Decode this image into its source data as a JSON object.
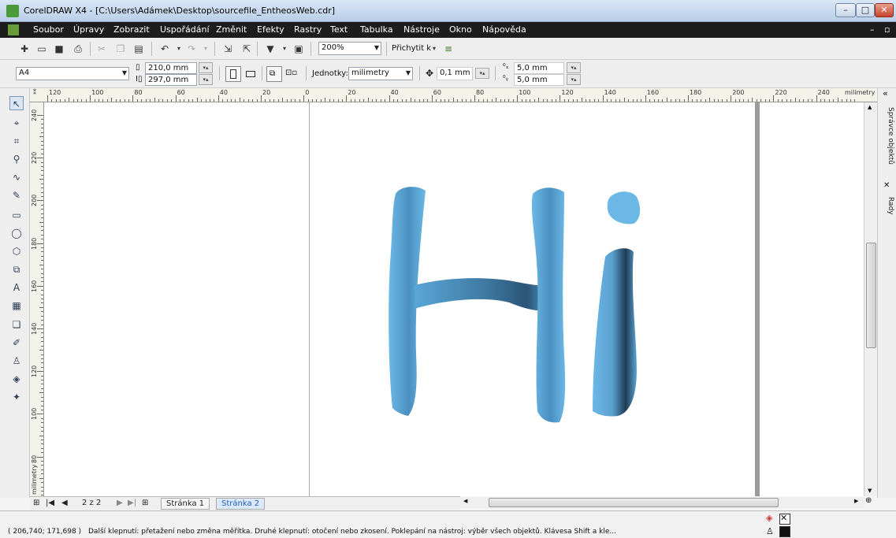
{
  "window": {
    "title": "CorelDRAW X4 - [C:\\Users\\Adámek\\Desktop\\sourcefile_EntheosWeb.cdr]",
    "minimize": "–",
    "maximize": "□",
    "close": "✕"
  },
  "menubar": {
    "items": [
      "Soubor",
      "Úpravy",
      "Zobrazit",
      "Uspořádání",
      "Změnit",
      "Efekty",
      "Rastry",
      "Text",
      "Tabulka",
      "Nástroje",
      "Okno",
      "Nápověda"
    ],
    "doc_min": "–",
    "doc_restore": "▫"
  },
  "toolbar_standard": {
    "zoom": "200%",
    "snap_label": "Přichytit k"
  },
  "toolbar_property": {
    "page_size": "A4",
    "width": "210,0 mm",
    "height": "297,0 mm",
    "units_label": "Jednotky:",
    "units_value": "milimetry",
    "nudge": "0,1 mm",
    "dup_x": "5,0 mm",
    "dup_y": "5,0 mm"
  },
  "ruler_h": {
    "labels": [
      "120",
      "100",
      "80",
      "60",
      "40",
      "20",
      "0",
      "20",
      "40",
      "60",
      "80",
      "100",
      "120",
      "140",
      "160",
      "180",
      "200",
      "220",
      "240"
    ],
    "unit": "milimetry"
  },
  "ruler_v": {
    "labels": [
      "240",
      "220",
      "200",
      "180",
      "160",
      "140",
      "120",
      "100",
      "80"
    ],
    "unit": "milimetry"
  },
  "canvas": {
    "artwork_text": "Hi",
    "colors": {
      "light_blue": "#6bb8e6",
      "mid_blue": "#4a8fc0",
      "dark_blue": "#1f3b52"
    }
  },
  "pagenav": {
    "page_counter": "2 z 2",
    "tabs": [
      "Stránka 1",
      "Stránka 2"
    ],
    "active_tab": 1
  },
  "docker": {
    "tabs": [
      "Správce objektů",
      "Rady"
    ],
    "collapse": "«",
    "close": "✕"
  },
  "statusbar": {
    "coords": "( 206,740; 171,698 )",
    "message": "Další klepnutí: přetažení nebo změna měřítka. Druhé klepnutí: otočení nebo zkosení. Poklepání na nástroj: výběr všech objektů. Klávesa Shift a kle..."
  }
}
